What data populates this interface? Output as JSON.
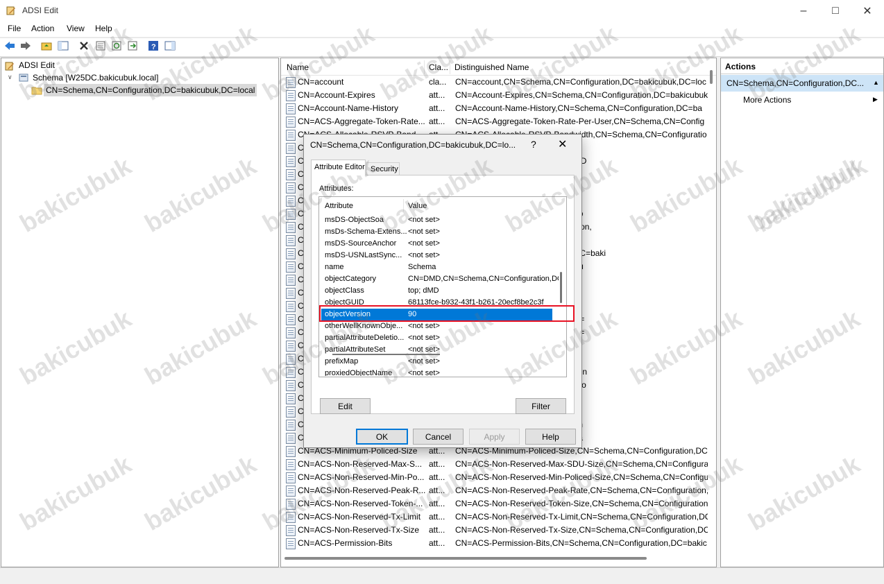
{
  "window": {
    "title": "ADSI Edit"
  },
  "menu": [
    "File",
    "Action",
    "View",
    "Help"
  ],
  "tree": {
    "root": "ADSI Edit",
    "schema": "Schema [W25DC.bakicubuk.local]",
    "selected": "CN=Schema,CN=Configuration,DC=bakicubuk,DC=local"
  },
  "list": {
    "columns": [
      "Name",
      "Cla...",
      "Distinguished Name"
    ],
    "rows": [
      {
        "name": "CN=account",
        "cls": "cla...",
        "dn": "CN=account,CN=Schema,CN=Configuration,DC=bakicubuk,DC=loc"
      },
      {
        "name": "CN=Account-Expires",
        "cls": "att...",
        "dn": "CN=Account-Expires,CN=Schema,CN=Configuration,DC=bakicubuk"
      },
      {
        "name": "CN=Account-Name-History",
        "cls": "att...",
        "dn": "CN=Account-Name-History,CN=Schema,CN=Configuration,DC=ba"
      },
      {
        "name": "CN=ACS-Aggregate-Token-Rate...",
        "cls": "att...",
        "dn": "CN=ACS-Aggregate-Token-Rate-Per-User,CN=Schema,CN=Config"
      },
      {
        "name": "CN=ACS-Allocable-RSVP-Band...",
        "cls": "att...",
        "dn": "CN=ACS-Allocable-RSVP-Bandwidth,CN=Schema,CN=Configuratio"
      },
      {
        "name": "Cl",
        "cls": "",
        "dn": "ema,CN=Configuration,DC=bakic"
      },
      {
        "name": "Cl",
        "cls": "",
        "dn": "CN=Configuration,DC=bakicubuk,D"
      },
      {
        "name": "Cl",
        "cls": "",
        "dn": "chema,CN=Configuration,DC=bak"
      },
      {
        "name": "Cl",
        "cls": "",
        "dn": "ma,CN=Configuration,DC=bakicu"
      },
      {
        "name": "Cl",
        "cls": "",
        "dn": "ema,CN=Configuration,DC=bakic"
      },
      {
        "name": "Cl",
        "cls": "",
        "dn": "=Schema,CN=Configuration,DC=b"
      },
      {
        "name": "Cl",
        "cls": "",
        "dn": "ging,CN=Schema,CN=Configuration,"
      },
      {
        "name": "Cl",
        "cls": "",
        "dn": "ogging,CN=Schema,CN=Configu"
      },
      {
        "name": "Cl",
        "cls": "",
        "dn": "CN=Schema,CN=Configuration,DC=baki"
      },
      {
        "name": "Cl",
        "cls": "",
        "dn": "ema,CN=Configuration,DC=bakicu"
      },
      {
        "name": "Cl",
        "cls": "",
        "dn": "te-Per-User,CN=Schema,CN=Con"
      },
      {
        "name": "Cl",
        "cls": "",
        "dn": "CN=Schema,CN=Configuration,D"
      },
      {
        "name": "Cl",
        "cls": "",
        "dn": "es,CN=Schema,CN=Configuration"
      },
      {
        "name": "Cl",
        "cls": "",
        "dn": "N=Schema,CN=Configuration,DC="
      },
      {
        "name": "Cl",
        "cls": "",
        "dn": "N=Schema,CN=Configuration,DC="
      },
      {
        "name": "Cl",
        "cls": "",
        "dn": "er-Flow,CN=Schema,CN=Configu"
      },
      {
        "name": "Cl",
        "cls": "",
        "dn": "unt-File,CN=Schema,CN=Configu"
      },
      {
        "name": "Cl",
        "cls": "",
        "dn": "File,CN=Schema,CN=Configuration"
      },
      {
        "name": "Cl",
        "cls": "",
        "dn": "Flow,CN=Schema,CN=Configuratio"
      },
      {
        "name": "Cl",
        "cls": "",
        "dn": "w,CN=Schema,CN=Configuration"
      },
      {
        "name": "Cl",
        "cls": "",
        "dn": "Schema,CN=Configuration,DC=b"
      },
      {
        "name": "Cl",
        "cls": "",
        "dn": "on,CN=Schema,CN=Configuration"
      },
      {
        "name": "Cl",
        "cls": "",
        "dn": "Schema,CN=Configuration,DC=ba"
      },
      {
        "name": "CN=ACS-Minimum-Policed-Size",
        "cls": "att...",
        "dn": "CN=ACS-Minimum-Policed-Size,CN=Schema,CN=Configuration,DC"
      },
      {
        "name": "CN=ACS-Non-Reserved-Max-S...",
        "cls": "att...",
        "dn": "CN=ACS-Non-Reserved-Max-SDU-Size,CN=Schema,CN=Configurat"
      },
      {
        "name": "CN=ACS-Non-Reserved-Min-Po...",
        "cls": "att...",
        "dn": "CN=ACS-Non-Reserved-Min-Policed-Size,CN=Schema,CN=Configu"
      },
      {
        "name": "CN=ACS-Non-Reserved-Peak-R...",
        "cls": "att...",
        "dn": "CN=ACS-Non-Reserved-Peak-Rate,CN=Schema,CN=Configuration,"
      },
      {
        "name": "CN=ACS-Non-Reserved-Token-...",
        "cls": "att...",
        "dn": "CN=ACS-Non-Reserved-Token-Size,CN=Schema,CN=Configuration"
      },
      {
        "name": "CN=ACS-Non-Reserved-Tx-Limit",
        "cls": "att...",
        "dn": "CN=ACS-Non-Reserved-Tx-Limit,CN=Schema,CN=Configuration,DC"
      },
      {
        "name": "CN=ACS-Non-Reserved-Tx-Size",
        "cls": "att...",
        "dn": "CN=ACS-Non-Reserved-Tx-Size,CN=Schema,CN=Configuration,DC="
      },
      {
        "name": "CN=ACS-Permission-Bits",
        "cls": "att...",
        "dn": "CN=ACS-Permission-Bits,CN=Schema,CN=Configuration,DC=bakic"
      }
    ]
  },
  "actions": {
    "header": "Actions",
    "selected": "CN=Schema,CN=Configuration,DC...",
    "more": "More Actions"
  },
  "dialog": {
    "title": "CN=Schema,CN=Configuration,DC=bakicubuk,DC=lo...",
    "help": "?",
    "tabs": [
      "Attribute Editor",
      "Security"
    ],
    "attributes_label": "Attributes:",
    "col_attribute": "Attribute",
    "col_value": "Value",
    "rows": [
      {
        "a": "msDS-ObjectSoa",
        "v": "<not set>"
      },
      {
        "a": "msDs-Schema-Extens...",
        "v": "<not set>"
      },
      {
        "a": "msDS-SourceAnchor",
        "v": "<not set>"
      },
      {
        "a": "msDS-USNLastSync...",
        "v": "<not set>"
      },
      {
        "a": "name",
        "v": "Schema"
      },
      {
        "a": "objectCategory",
        "v": "CN=DMD,CN=Schema,CN=Configuration,DC"
      },
      {
        "a": "objectClass",
        "v": "top; dMD"
      },
      {
        "a": "objectGUID",
        "v": "68113fce-b932-43f1-b261-20ecf8be2c3f"
      },
      {
        "a": "objectVersion",
        "v": "90"
      },
      {
        "a": "otherWellKnownObje...",
        "v": "<not set>"
      },
      {
        "a": "partialAttributeDeletio...",
        "v": "<not set>"
      },
      {
        "a": "partialAttributeSet",
        "v": "<not set>"
      },
      {
        "a": "prefixMap",
        "v": "<not set>"
      },
      {
        "a": "proxiedObjectName",
        "v": "<not set>"
      }
    ],
    "edit": "Edit",
    "filter": "Filter",
    "ok": "OK",
    "cancel": "Cancel",
    "apply": "Apply",
    "helpbtn": "Help"
  },
  "watermark": "bakicubuk",
  "colors": {
    "selection": "#0078d7",
    "highlight_box": "#e81123"
  }
}
